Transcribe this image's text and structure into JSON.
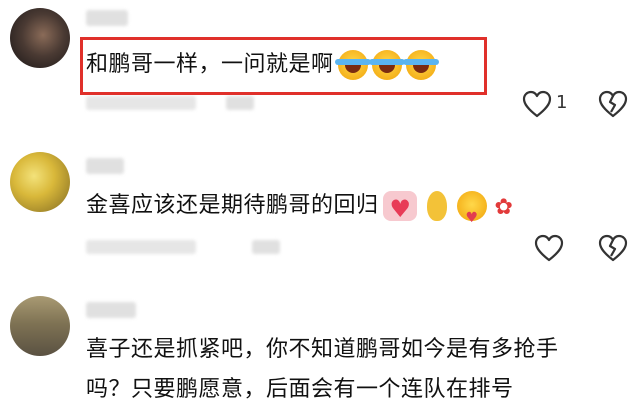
{
  "comments": [
    {
      "text": "和鹏哥一样，一问就是啊",
      "emojis": [
        "laugh-crying-emoji",
        "laugh-crying-emoji",
        "laugh-crying-emoji"
      ],
      "like_count": "1"
    },
    {
      "text": "金喜应该还是期待鹏哥的回归",
      "emojis": [
        "heart-box-emoji",
        "gourd-emoji",
        "hug-emoji",
        "rose-emoji"
      ]
    },
    {
      "text_line1": "喜子还是抓紧吧，你不知道鹏哥如今是有多抢手",
      "text_line2": "吗？只要鹏愿意，后面会有一个连队在排号"
    }
  ],
  "colors": {
    "highlight_border": "#e0302a",
    "icon_stroke": "#333333"
  }
}
